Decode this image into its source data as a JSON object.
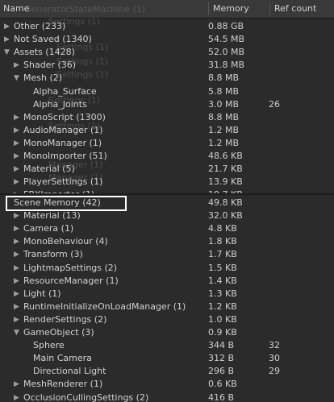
{
  "header": {
    "name": "Name",
    "memory": "Memory",
    "ref_count": "Ref count"
  },
  "ghost": {
    "line1": "GeneratorStateMachine (1)",
    "line2": "Settings (1)",
    "line3": "Settings (1)",
    "line4": "Settings (1)",
    "line5": "Settings (1)",
    "line6": "Settings (1)",
    "line7": "Settings (1)",
    "line8": "Manager (1)",
    "line9": "Manager (1)"
  },
  "top_rows": [
    {
      "arrow": "▶",
      "label": "Other (233)",
      "memory": "0.88 GB",
      "ref": ""
    },
    {
      "arrow": "▶",
      "label": "Not Saved (1340)",
      "memory": "54.5 MB",
      "ref": ""
    },
    {
      "arrow": "▼",
      "label": "Assets (1428)",
      "memory": "52.0 MB",
      "ref": ""
    },
    {
      "arrow": "▶",
      "label": "Shader (36)",
      "memory": "31.8 MB",
      "ref": ""
    },
    {
      "arrow": "▼",
      "label": "Mesh (2)",
      "memory": "8.8 MB",
      "ref": ""
    },
    {
      "arrow": "",
      "label": "Alpha_Surface",
      "memory": "5.8 MB",
      "ref": ""
    },
    {
      "arrow": "",
      "label": "Alpha_Joints",
      "memory": "3.0 MB",
      "ref": "26"
    },
    {
      "arrow": "▶",
      "label": "MonoScript (1300)",
      "memory": "8.8 MB",
      "ref": ""
    },
    {
      "arrow": "▶",
      "label": "AudioManager (1)",
      "memory": "1.2 MB",
      "ref": ""
    },
    {
      "arrow": "▶",
      "label": "MonoManager (1)",
      "memory": "1.2 MB",
      "ref": ""
    },
    {
      "arrow": "▶",
      "label": "MonoImporter (51)",
      "memory": "48.6 KB",
      "ref": ""
    },
    {
      "arrow": "▶",
      "label": "Material (5)",
      "memory": "21.7 KB",
      "ref": ""
    },
    {
      "arrow": "▶",
      "label": "PlayerSettings (1)",
      "memory": "13.9 KB",
      "ref": ""
    },
    {
      "arrow": "▶",
      "label": "FBXImporter (1)",
      "memory": "10.7 KB",
      "ref": ""
    }
  ],
  "bottom_rows": [
    {
      "arrow": "",
      "label": "Scene Memory (42)",
      "memory": "49.8 KB",
      "ref": ""
    },
    {
      "arrow": "▶",
      "label": "Material (13)",
      "memory": "32.0 KB",
      "ref": ""
    },
    {
      "arrow": "▶",
      "label": "Camera (1)",
      "memory": "4.8 KB",
      "ref": ""
    },
    {
      "arrow": "▶",
      "label": "MonoBehaviour (4)",
      "memory": "1.8 KB",
      "ref": ""
    },
    {
      "arrow": "▶",
      "label": "Transform (3)",
      "memory": "1.7 KB",
      "ref": ""
    },
    {
      "arrow": "▶",
      "label": "LightmapSettings (2)",
      "memory": "1.5 KB",
      "ref": ""
    },
    {
      "arrow": "▶",
      "label": "ResourceManager (1)",
      "memory": "1.4 KB",
      "ref": ""
    },
    {
      "arrow": "▶",
      "label": "Light (1)",
      "memory": "1.3 KB",
      "ref": ""
    },
    {
      "arrow": "▶",
      "label": "RuntimeInitializeOnLoadManager (1)",
      "memory": "1.2 KB",
      "ref": ""
    },
    {
      "arrow": "▶",
      "label": "RenderSettings (2)",
      "memory": "1.0 KB",
      "ref": ""
    },
    {
      "arrow": "▼",
      "label": "GameObject (3)",
      "memory": "0.9 KB",
      "ref": ""
    },
    {
      "arrow": "",
      "label": "Sphere",
      "memory": "344 B",
      "ref": "32"
    },
    {
      "arrow": "",
      "label": "Main Camera",
      "memory": "312 B",
      "ref": "30"
    },
    {
      "arrow": "",
      "label": "Directional Light",
      "memory": "296 B",
      "ref": "29"
    },
    {
      "arrow": "▶",
      "label": "MeshRenderer (1)",
      "memory": "0.6 KB",
      "ref": ""
    },
    {
      "arrow": "▶",
      "label": "OcclusionCullingSettings (2)",
      "memory": "416 B",
      "ref": ""
    }
  ]
}
